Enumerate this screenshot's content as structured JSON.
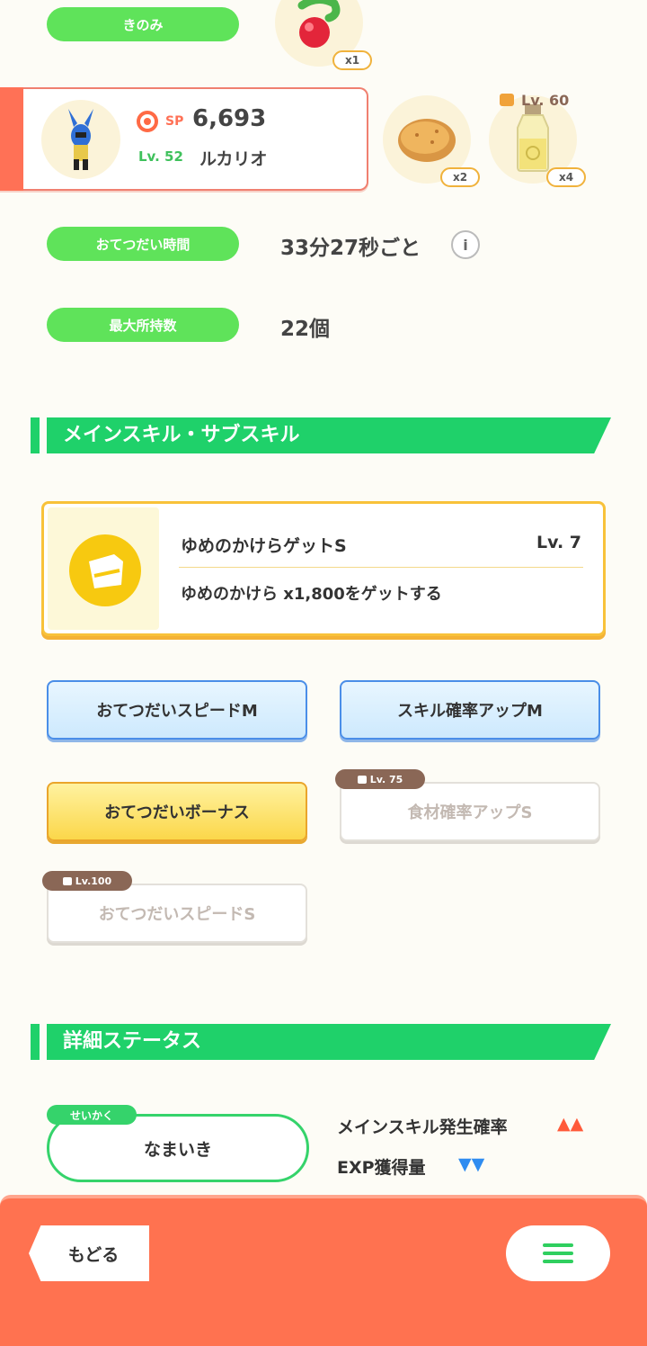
{
  "berry": {
    "label": "きのみ",
    "qty": "x1"
  },
  "pokemon": {
    "sp_label": "SP",
    "sp_value": "6,693",
    "level": "Lv. 52",
    "name": "ルカリオ"
  },
  "ingredients": [
    {
      "name": "potato-icon",
      "qty": "x2"
    },
    {
      "name": "oil-icon",
      "qty": "x4",
      "lock_level": "Lv. 60"
    }
  ],
  "help_time": {
    "label": "おてつだい時間",
    "value": "33分27秒ごと"
  },
  "max_carry": {
    "label": "最大所持数",
    "value": "22個"
  },
  "skills_section": {
    "title": "メインスキル・サブスキル"
  },
  "main_skill": {
    "name": "ゆめのかけらゲットS",
    "level": "Lv. 7",
    "description": "ゆめのかけら x1,800をゲットする"
  },
  "sub_skills": [
    {
      "label": "おてつだいスピードM",
      "style": "blue"
    },
    {
      "label": "スキル確率アップM",
      "style": "blue"
    },
    {
      "label": "おてつだいボーナス",
      "style": "gold"
    },
    {
      "label": "食材確率アップS",
      "style": "locked",
      "lock": "Lv. 75"
    },
    {
      "label": "おてつだいスピードS",
      "style": "locked",
      "lock": "Lv.100"
    }
  ],
  "details_section": {
    "title": "詳細ステータス"
  },
  "nature": {
    "tag": "せいかく",
    "value": "なまいき",
    "up_label": "メインスキル発生確率",
    "up_marks": "▲▲",
    "down_label": "EXP獲得量",
    "down_marks": "▼▼"
  },
  "nav": {
    "back": "もどる"
  },
  "colors": {
    "accent_green": "#1fd16a",
    "accent_orange": "#ff7250",
    "up": "#ff5a3a",
    "down": "#2f8cf0"
  }
}
